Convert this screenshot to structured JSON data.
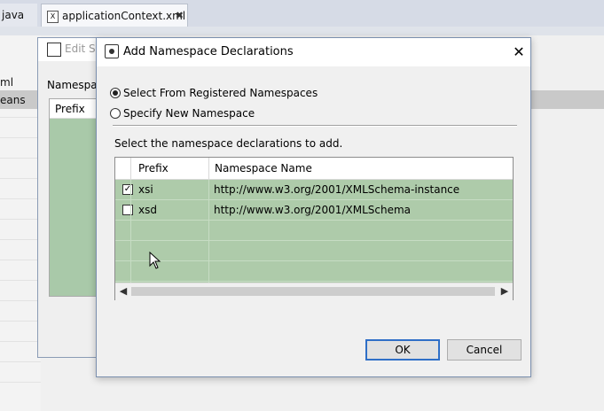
{
  "ide": {
    "tabs": [
      {
        "label": "java"
      },
      {
        "label": "applicationContext.xml",
        "icon": "xml-file-icon",
        "close": "✖"
      }
    ],
    "sidebar": [
      "ml",
      "eans"
    ]
  },
  "behind_dialog": {
    "title": "Edit Sc",
    "label": "Namespac",
    "column": "Prefix"
  },
  "dialog": {
    "title": "Add Namespace Declarations",
    "close": "✕",
    "radio_registered": "Select From Registered Namespaces",
    "radio_new": "Specify New Namespace",
    "selected_radio": "registered",
    "instruction": "Select the namespace declarations to add.",
    "table": {
      "headers": [
        "Prefix",
        "Namespace Name"
      ],
      "rows": [
        {
          "checked": true,
          "prefix": "xsi",
          "namespace": "http://www.w3.org/2001/XMLSchema-instance"
        },
        {
          "checked": false,
          "prefix": "xsd",
          "namespace": "http://www.w3.org/2001/XMLSchema"
        }
      ],
      "row_color": "#aecbaa"
    },
    "ok_label": "OK",
    "cancel_label": "Cancel"
  }
}
